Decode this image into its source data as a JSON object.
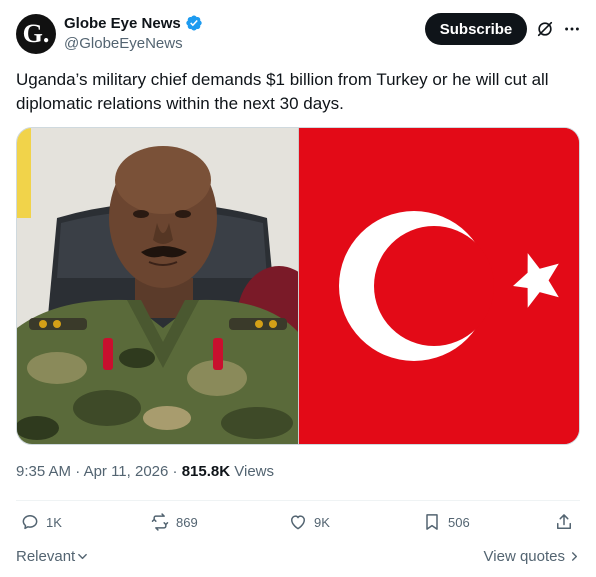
{
  "author": {
    "avatar_letter": "G.",
    "display_name": "Globe Eye News",
    "handle": "@GlobeEyeNews",
    "verified_color": "#1d9bf0"
  },
  "header": {
    "subscribe_label": "Subscribe",
    "grok_icon": "grok-icon",
    "more_icon": "more-icon"
  },
  "tweet": {
    "text": "Uganda’s military chief demands $1 billion from Turkey or he will cut all diplomatic relations within the next 30 days."
  },
  "media": {
    "left_image": "photo of military officer in camouflage uniform",
    "right_image": "Turkish flag",
    "flag_color": "#e30a17"
  },
  "meta": {
    "time": "9:35 AM",
    "separator": " · ",
    "date": "Apr 11, 2026",
    "views_count": "815.8K",
    "views_label": "Views"
  },
  "actions": {
    "replies": "1K",
    "reposts": "869",
    "likes": "9K",
    "bookmarks": "506"
  },
  "footer": {
    "relevant_label": "Relevant",
    "view_quotes_label": "View quotes"
  },
  "colors": {
    "text": "#0f1419",
    "secondary": "#536471",
    "accent": "#1d9bf0"
  }
}
